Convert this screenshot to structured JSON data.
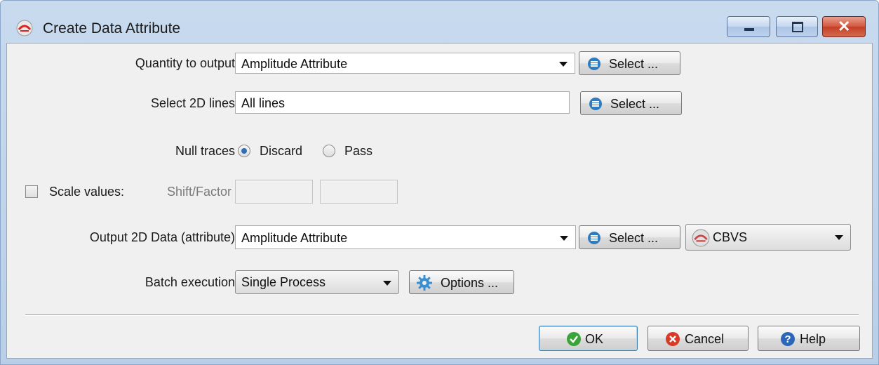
{
  "window": {
    "title": "Create Data Attribute",
    "controls": {
      "minimize": "minimize",
      "maximize": "maximize",
      "close": "close"
    }
  },
  "form": {
    "quantity": {
      "label": "Quantity to output",
      "value": "Amplitude Attribute",
      "select_label": "Select ..."
    },
    "lines": {
      "label": "Select 2D lines",
      "value": "All lines",
      "select_label": "Select ..."
    },
    "null_traces": {
      "label": "Null traces",
      "options": [
        "Discard",
        "Pass"
      ],
      "selected": "Discard"
    },
    "scale": {
      "checkbox_label": "Scale values:",
      "sub_label": "Shift/Factor",
      "checked": false,
      "shift": "",
      "factor": ""
    },
    "output": {
      "label": "Output 2D Data (attribute)",
      "value": "Amplitude Attribute",
      "select_label": "Select ...",
      "format": "CBVS"
    },
    "batch": {
      "label": "Batch execution",
      "value": "Single Process",
      "options_label": "Options ..."
    }
  },
  "footer": {
    "ok_label": "OK",
    "cancel_label": "Cancel",
    "help_label": "Help"
  },
  "colors": {
    "accent": "#2f7cc0",
    "ok_green": "#3aa33a",
    "cancel_red": "#d83a28",
    "help_blue": "#2b66b8"
  },
  "icons": {
    "title": "app-logo-icon",
    "select": "list-icon",
    "options": "gear-icon",
    "ok": "check-icon",
    "cancel": "cancel-icon",
    "help": "help-icon"
  }
}
